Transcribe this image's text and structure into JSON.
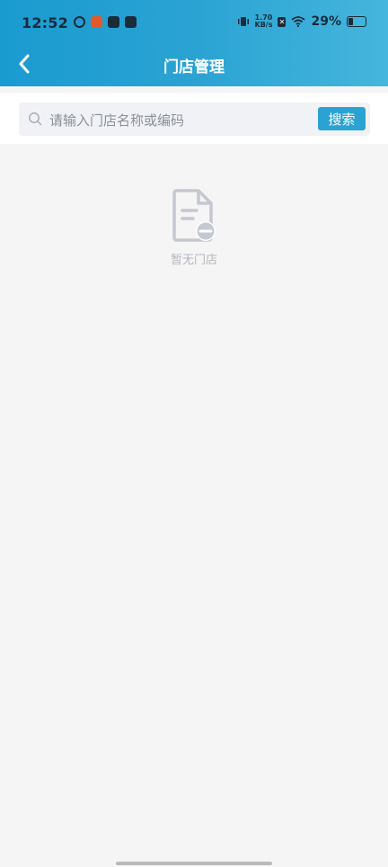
{
  "status_bar": {
    "time": "12:52",
    "net_speed_value": "1.70",
    "net_speed_unit": "KB/s",
    "sim_label": "✕",
    "battery_percent": "29%",
    "battery_level": 0.29
  },
  "nav": {
    "title": "门店管理"
  },
  "search": {
    "placeholder": "请输入门店名称或编码",
    "value": "",
    "button_label": "搜索"
  },
  "empty": {
    "message": "暂无门店"
  },
  "colors": {
    "header_start": "#1a9bd0",
    "header_end": "#45b6dd",
    "accent": "#2aa3d3",
    "background": "#f5f5f5"
  }
}
